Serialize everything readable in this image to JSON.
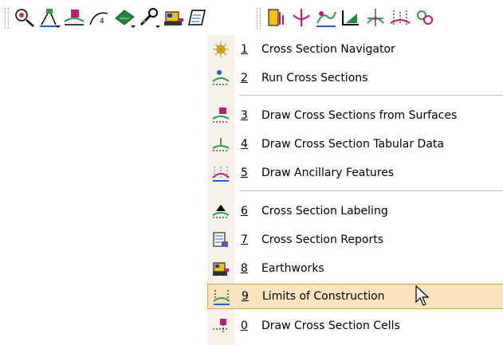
{
  "toolbar": {
    "left_buttons": [
      {
        "icon": "cross-section-navigator-icon"
      },
      {
        "icon": "survey-icon"
      },
      {
        "icon": "draw-cross-sections-icon"
      },
      {
        "icon": "alignment-icon"
      },
      {
        "icon": "surface-icon"
      },
      {
        "icon": "wrench-icon"
      },
      {
        "icon": "earthworks-icon"
      },
      {
        "icon": "notepad-icon"
      }
    ],
    "right_buttons": [
      {
        "icon": "report-icon"
      },
      {
        "icon": "profile-icon"
      },
      {
        "icon": "drainage-icon"
      },
      {
        "icon": "terrain-icon"
      },
      {
        "icon": "labels-icon"
      },
      {
        "icon": "limits-icon"
      },
      {
        "icon": "cells-icon"
      }
    ]
  },
  "menu": {
    "items": [
      {
        "number": "1",
        "label": "Cross Section Navigator",
        "icon": "navigator-icon"
      },
      {
        "number": "2",
        "label": "Run Cross Sections",
        "icon": "run-cross-sections-icon"
      },
      {
        "number": "3",
        "label": "Draw Cross Sections from Surfaces",
        "icon": "draw-from-surfaces-icon"
      },
      {
        "number": "4",
        "label": "Draw Cross Section Tabular Data",
        "icon": "tabular-data-icon"
      },
      {
        "number": "5",
        "label": "Draw Ancillary Features",
        "icon": "ancillary-features-icon"
      },
      {
        "number": "6",
        "label": "Cross Section Labeling",
        "icon": "labeling-icon"
      },
      {
        "number": "7",
        "label": "Cross Section Reports",
        "icon": "reports-icon"
      },
      {
        "number": "8",
        "label": "Earthworks",
        "icon": "earthworks-icon"
      },
      {
        "number": "9",
        "label": "Limits of Construction",
        "icon": "limits-icon"
      },
      {
        "number": "0",
        "label": "Draw Cross Section Cells",
        "icon": "cells-icon"
      }
    ],
    "highlighted_index": 8
  },
  "colors": {
    "highlight_bg": "#fbe3bf",
    "highlight_border": "#e5a54a",
    "gutter": "#f3f1ea"
  }
}
